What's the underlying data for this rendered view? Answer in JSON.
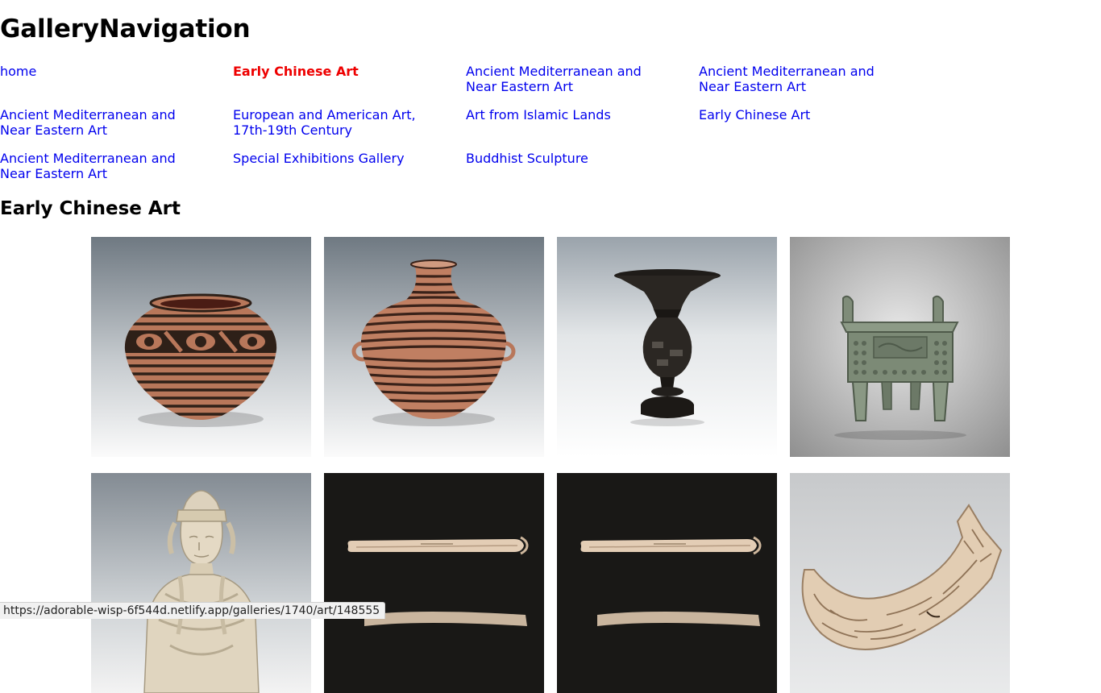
{
  "site": {
    "title": "GalleryNavigation"
  },
  "nav": {
    "items": [
      {
        "label": "home",
        "active": false
      },
      {
        "label": "Early Chinese Art",
        "active": true
      },
      {
        "label": "Ancient Mediterranean and Near Eastern Art",
        "active": false
      },
      {
        "label": "Ancient Mediterranean and Near Eastern Art",
        "active": false
      },
      {
        "label": "Ancient Mediterranean and Near Eastern Art",
        "active": false
      },
      {
        "label": "European and American Art, 17th-19th Century",
        "active": false
      },
      {
        "label": "Art from Islamic Lands",
        "active": false
      },
      {
        "label": "Early Chinese Art",
        "active": false
      },
      {
        "label": "Ancient Mediterranean and Near Eastern Art",
        "active": false
      },
      {
        "label": "Special Exhibitions Gallery",
        "active": false
      },
      {
        "label": "Buddhist Sculpture",
        "active": false
      }
    ]
  },
  "gallery": {
    "title": "Early Chinese Art",
    "tiles": [
      {
        "depicts": "painted-jar-icon"
      },
      {
        "depicts": "painted-handled-jar-icon"
      },
      {
        "depicts": "black-goblet-icon"
      },
      {
        "depicts": "bronze-ding-icon"
      },
      {
        "depicts": "bodhisattva-statue-icon"
      },
      {
        "depicts": "bone-hairpins-icon"
      },
      {
        "depicts": "bone-hairpins-icon"
      },
      {
        "depicts": "carved-horn-icon"
      }
    ]
  },
  "status_bar": {
    "url": "https://adorable-wisp-6f544d.netlify.app/galleries/1740/art/148555"
  },
  "colors": {
    "link": "#0000ee",
    "active_link": "#ee0000"
  }
}
